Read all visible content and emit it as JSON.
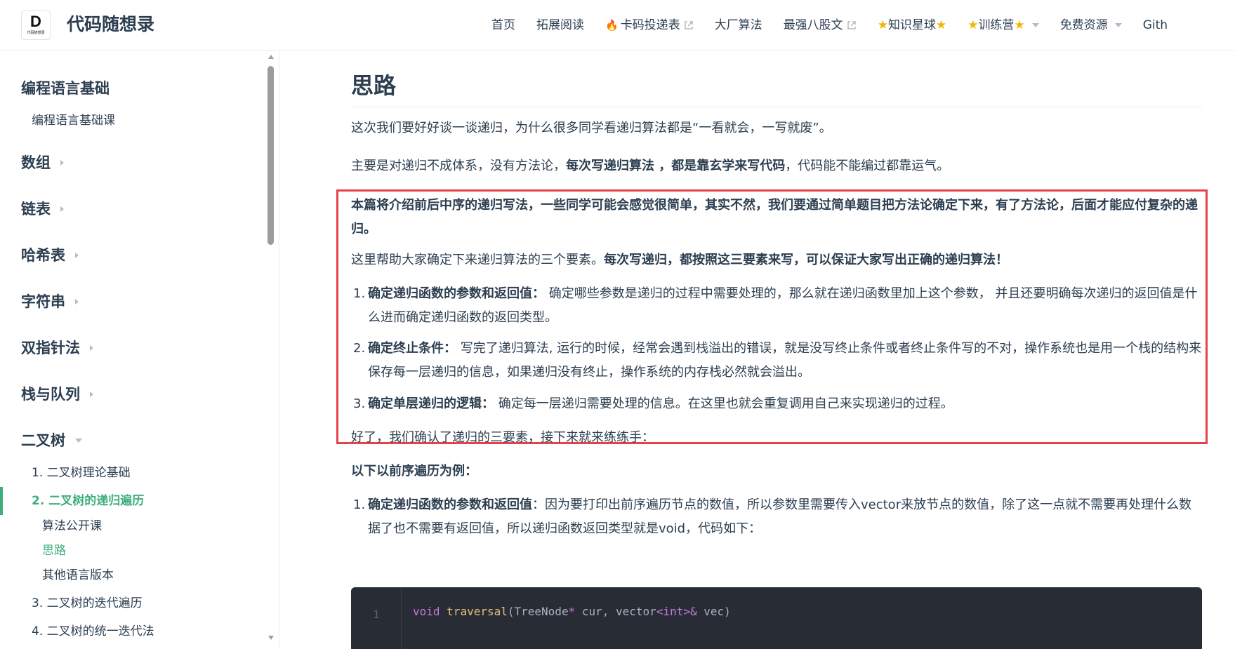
{
  "brand": {
    "logo_letter": "D",
    "logo_caption": "代码随想录",
    "site_name": "代码随想录"
  },
  "nav": {
    "items": [
      {
        "label": "首页"
      },
      {
        "label": "拓展阅读"
      },
      {
        "label": "卡码投递表",
        "icon": "fire-icon",
        "external": true
      },
      {
        "label": "大厂算法"
      },
      {
        "label": "最强八股文",
        "external": true
      },
      {
        "label": "知识星球",
        "icon": "star-icon"
      },
      {
        "label": "训练营",
        "icon": "star-icon",
        "dropdown": true
      },
      {
        "label": "免费资源",
        "dropdown": true
      },
      {
        "label": "Gith"
      }
    ]
  },
  "sidebar": {
    "groups": [
      {
        "label": "编程语言基础",
        "expanded": true
      },
      {
        "label": "数组"
      },
      {
        "label": "链表"
      },
      {
        "label": "哈希表"
      },
      {
        "label": "字符串"
      },
      {
        "label": "双指针法"
      },
      {
        "label": "栈与队列"
      },
      {
        "label": "二叉树",
        "expanded": true
      }
    ],
    "lang_child": "编程语言基础课",
    "tree_children": [
      "1. 二叉树理论基础",
      "2. 二叉树的递归遍历",
      "3. 二叉树的迭代遍历",
      "4. 二叉树的统一迭代法"
    ],
    "active_sub": [
      "算法公开课",
      "思路",
      "其他语言版本"
    ],
    "active_color": "#3eaf7c"
  },
  "content": {
    "title": "思路",
    "p1": "这次我们要好好谈一谈递归，为什么很多同学看递归算法都是“一看就会，一写就废”。",
    "p2_a": "主要是对递归不成体系，没有方法论，",
    "p2_b": "每次写递归算法 ，都是靠玄学来写代码",
    "p2_c": "，代码能不能编过都靠运气。",
    "p3": "本篇将介绍前后中序的递归写法，一些同学可能会感觉很简单，其实不然，我们要通过简单题目把方法论确定下来，有了方法论，后面才能应付复杂的递归。",
    "p4_a": "这里帮助大家确定下来递归算法的三个要素。",
    "p4_b": "每次写递归，都按照这三要素来写，可以保证大家写出正确的递归算法！",
    "steps": [
      {
        "num": "1.",
        "head": "确定递归函数的参数和返回值：",
        "body": " 确定哪些参数是递归的过程中需要处理的，那么就在递归函数里加上这个参数， 并且还要明确每次递归的返回值是什么进而确定递归函数的返回类型。"
      },
      {
        "num": "2.",
        "head": "确定终止条件：",
        "body": " 写完了递归算法, 运行的时候，经常会遇到栈溢出的错误，就是没写终止条件或者终止条件写的不对，操作系统也是用一个栈的结构来保存每一层递归的信息，如果递归没有终止，操作系统的内存栈必然就会溢出。"
      },
      {
        "num": "3.",
        "head": "确定单层递归的逻辑：",
        "body": " 确定每一层递归需要处理的信息。在这里也就会重复调用自己来实现递归的过程。"
      }
    ],
    "p5": "好了，我们确认了递归的三要素，接下来就来练练手：",
    "p6": "以下以前序遍历为例：",
    "step4": {
      "num": "1.",
      "head": "确定递归函数的参数和返回值",
      "body": "：因为要打印出前序遍历节点的数值，所以参数里需要传入vector来放节点的数值，除了这一点就不需要再处理什么数据了也不需要有返回值，所以递归函数返回类型就是void，代码如下："
    },
    "highlight_color": "#e8414b",
    "code": {
      "line_number": "1",
      "t1": "void",
      "t2": " ",
      "t3": "traversal",
      "t4": "(TreeNode",
      "t5": "*",
      "t6": " cur, vector",
      "t7": "<",
      "t8": "int",
      "t9": ">&",
      "t10": " vec)"
    }
  }
}
